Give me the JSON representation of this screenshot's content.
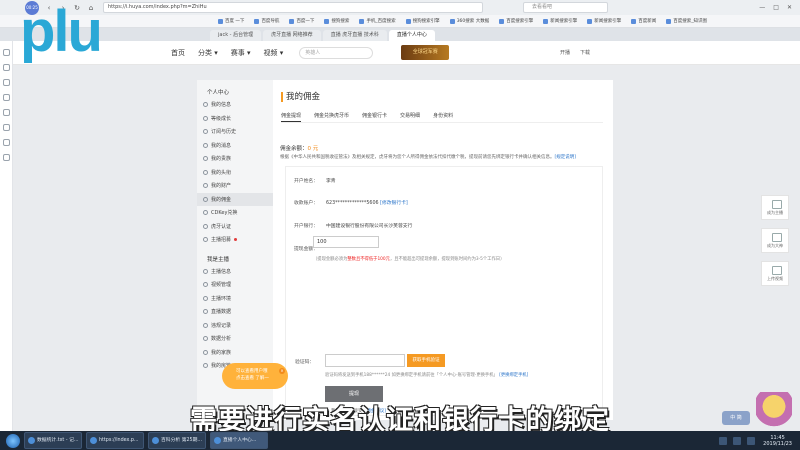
{
  "browser": {
    "speed_label": "00:25",
    "url": "https://i.huya.com/index.php?m=ZhiHu",
    "search_placeholder": "去看看吧",
    "bookmarks": [
      "百度 一下",
      "百度导航",
      "百度一下",
      "搜狗搜索",
      "手机_百度搜索",
      "搜狗搜索引擎",
      "360搜索 大数据",
      "百度搜索引擎",
      "新闻搜索引擎",
      "新闻搜索引擎",
      "百度新闻",
      "百度搜索_知识图"
    ],
    "tabs": [
      "jack - 后台管理",
      "虎牙直播 网络推荐",
      "直播 虎牙直播 技术科",
      "直播个人中心"
    ],
    "active_tab": "直播个人中心"
  },
  "site": {
    "logo": "plu",
    "nav": [
      "首页",
      "分类 ▾",
      "赛事 ▾",
      "视频 ▾"
    ],
    "search_placeholder": "英雄人",
    "banner": "全球冠军赛",
    "header_right": [
      "开播",
      "下载"
    ]
  },
  "sidebar": {
    "section1_title": "个人中心",
    "items1": [
      "我的信息",
      "等级成长",
      "订阅与历史",
      "我的消息",
      "我的贵族",
      "我的头衔",
      "我的财产",
      "我的佣金",
      "CDKey兑换",
      "虎牙认证",
      "主播招募"
    ],
    "active_item": "我的佣金",
    "section2_title": "我是主播",
    "items2": [
      "主播信息",
      "视频管理",
      "主播环境",
      "直播数据",
      "违规记录",
      "数据分析",
      "我的家族",
      "我的房管"
    ]
  },
  "main": {
    "title": "我的佣金",
    "subtabs": [
      "佣金提现",
      "佣金兑换虎牙币",
      "佣金银行卡",
      "交易明细",
      "身份资料"
    ],
    "active_subtab": "佣金提现",
    "balance_label": "佣金余额：",
    "balance_value": "0 元",
    "notice": "根据《中华人民共和国税收征管法》及相关规定，虎牙将为您个人所得佣金依法代扣代缴个税，提现前请您先绑定银行卡并确认相关信息。",
    "notice_link": "[规定说明]",
    "holder_label": "开户姓名：",
    "holder_value": "李青",
    "account_label": "收款账户：",
    "account_value": "623*************5606",
    "account_link": "[修改银行卡]",
    "bank_label": "开户银行：",
    "bank_value": "中国建设银行股份有限公司长沙芙蓉支行",
    "amount_label": "提现金额：",
    "amount_value": "100",
    "hint_prefix": "（提现金额必须为",
    "hint_red": "整数且不得低于100元",
    "hint_suffix": "，且不能超出可提现余额，提现到账时间约为3-5个工作日）",
    "code_label": "验证码：",
    "code_button": "获取手机验证",
    "code_hint": "验证码将发送到手机188******24 如更换绑定手机请前往「个人中心-账号管理-更换手机」",
    "code_hint_link": "[更换绑定手机]",
    "withdraw_button": "提现",
    "agree_text": "我已阅读并接受",
    "agree_link": "[佣金协议]"
  },
  "float_tools": [
    "成为主播",
    "成为大神",
    "上传视频"
  ],
  "promo": {
    "line1": "可以查看用户哦",
    "line2": "点击查看 了解一",
    "close": "×"
  },
  "mini_widget": "中 简",
  "subtitle": "需要进行实名认证和银行卡的绑定",
  "taskbar": {
    "tasks": [
      "数据统计.txt - 记...",
      "https://index.p...",
      "百科分析 第25期...",
      "直播个人中心..."
    ],
    "active_task": "直播个人中心...",
    "time": "11:45",
    "date": "2019/11/23"
  }
}
